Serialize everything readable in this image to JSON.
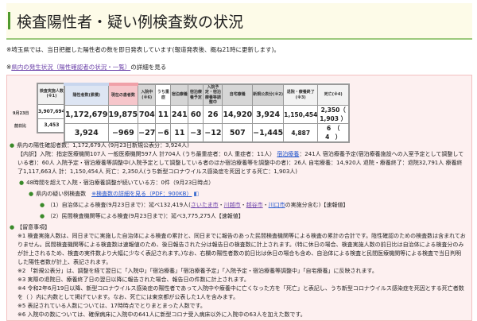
{
  "title": "検査陽性者・疑い例検査数の状況",
  "note": "※埼玉県では、当日把握した陽性者の数を即日発表しています(報道発表後、概ね21時に更新します)。",
  "link_prefix": "※",
  "link_text": "県内の発生状況（陽性確認者の状況・一覧）",
  "link_suffix": "の詳細を見る",
  "table": {
    "row_labels": [
      "9月23日",
      "前日比"
    ],
    "test_header": "検査実施人数(※1)",
    "test_values": [
      "3,907,694",
      "3,453"
    ],
    "headers": [
      "陽性者数(累積)",
      "現在の患者数",
      "入院中(※6)",
      "うち重症",
      "宿泊療養",
      "宿泊療養予定",
      "入院予定・宿泊療養等調整中",
      "自宅療養",
      "新規公表分(※2)",
      "退院・療養終了(※3)",
      "死亡(※4)"
    ],
    "rows": [
      [
        "1,172,679",
        "19,875",
        "704",
        "11",
        "241",
        "60",
        "26",
        "14,920",
        "3,924",
        "1,150,454",
        "2,350（ 1,903 ）"
      ],
      [
        "3,924",
        "−969",
        "−27",
        "−6",
        "11",
        "−3",
        "−12",
        "507",
        "−1,445",
        "4,887",
        "6　（　4　）"
      ]
    ]
  },
  "summary": {
    "line1": "県内の陽性確認者数：1,172,679人 (9月23日新規公表分：3,924人)",
    "detail_a": "【内訳】入院：指定医療機関107人 一般医療機関597人 計704人 (うち最重症者：0人 重症者：11人）",
    "detail_link": "宿泊療養",
    "detail_b": "：241人 宿泊療養予定(宿泊療養施設への入室予定として調整している者)：60人 入院予定・宿泊療養等調整中(入院予定として調整している者のほか宿泊療養等を調整中の者)：26人 自宅療養：14,920人 退院・療養終了：退院32,791人 療養終了1,117,663人 計：1,150,454人 死亡：2,350人(うち新型コロナウイルス感染症を死因とする死亡：1,903人)",
    "line2": "48時間を超えて入院・宿泊療養調整が続いている方：0件（9月23日時点）",
    "line3": "県内の疑い例検査数",
    "pdf_link": "※検査数の詳細を見る（PDF：900KB）",
    "sub1_a": "（1）自治体による検査(9月23日まで)：延べ132,419人(",
    "cities": [
      "さいたま市",
      "川越市",
      "越谷市",
      "川口市"
    ],
    "sub1_b": "の実施分含む)【速報値】",
    "sub2": "（2）民間検査機関等による検査(9月23日まで)：延べ3,775,275人【速報値】"
  },
  "notes": {
    "heading": "【留意事項】",
    "n1": "※1 検査実施人数は、同日までに実施した自治体による検査の累計と、同日までに報告のあった民間検査機関等による検査の累計の合計です。陰性確認のための検査数は含まれておりません。民間検査機関等による検査数は速報値のため、後日報告された分は報告日の検査数に計上されます。(特に休日の場合、検査実施人数の前日比は自治体による検査分のみが計上されるため、検査の実件数より大幅に少なく表記されます。)なお、右欄の陽性者数の前日比は休日の場合も含め、自治体による検査と民間医療機関等による検査で当日判明した陽性者数が計上、表記されます。",
    "n2": "※2 「新規公表分」は、調整を経て翌日に「入院中」「宿泊療養」「宿泊療養予定」「入院予定・宿泊療養等調整中」「自宅療養」に反映されます。",
    "n3": "※3 実際の退院日、療養終了日の翌日以降に報告された場合、報告日の件数に計上されます。",
    "n4": "※4 令和2年6月19日以降、新型コロナウイルス感染症の陽性者であって入院中や療養中に亡くなった方を「死亡」と表記し、うち新型コロナウイルス感染症を死因とする死亡者数を（ ）内に内数として掲げています。なお、死亡には東京都が公表した1人を含みます。",
    "n5": "※5 表記されている人数については、17時時点でとりまとまった人数です。",
    "n6": "※6 入院中の数については、確保病床に入院中の641人に新型コロナ受入病床以外に入院中の63人を加えた数です。"
  }
}
